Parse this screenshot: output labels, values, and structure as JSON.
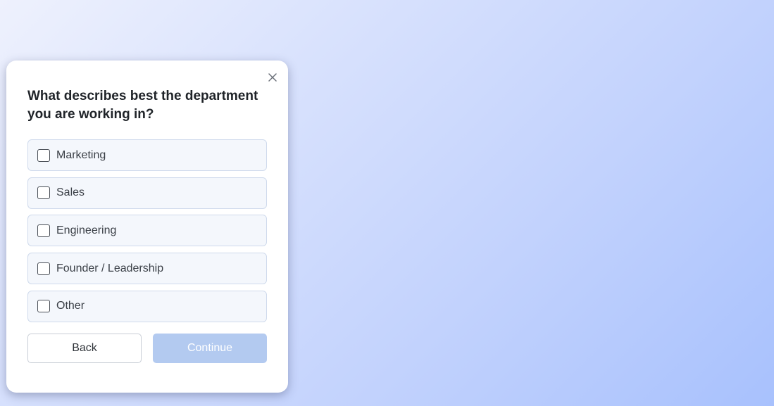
{
  "dialog": {
    "close_icon": "close-icon",
    "question": "What describes best the department you are working in?",
    "options": [
      {
        "label": "Marketing",
        "checked": false
      },
      {
        "label": "Sales",
        "checked": false
      },
      {
        "label": "Engineering",
        "checked": false
      },
      {
        "label": "Founder / Leadership",
        "checked": false
      },
      {
        "label": "Other",
        "checked": false
      }
    ],
    "back_label": "Back",
    "continue_label": "Continue",
    "continue_disabled": true
  },
  "colors": {
    "accent_disabled": "#b3caf0",
    "option_background": "#f4f7fc",
    "option_border": "#cfdaec",
    "text": "#1f2328"
  }
}
